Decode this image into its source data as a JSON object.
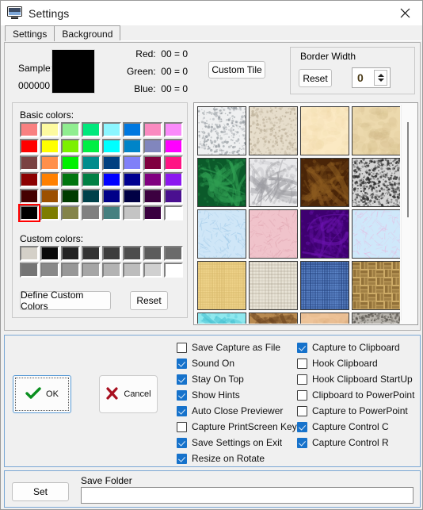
{
  "window": {
    "title": "Settings",
    "icon": "monitor-icon",
    "close_label": "✕"
  },
  "tabs": [
    {
      "label": "Settings",
      "active": false
    },
    {
      "label": "Background",
      "active": true
    }
  ],
  "background_tab": {
    "sample": {
      "label": "Sample:",
      "hex": "000000",
      "color": "#000000"
    },
    "channels": [
      {
        "name": "Red:",
        "hex": "00",
        "value": "0",
        "text": "Red:  00 = 0"
      },
      {
        "name": "Green:",
        "hex": "00",
        "value": "0",
        "text": "Green:  00 = 0"
      },
      {
        "name": "Blue:",
        "hex": "00",
        "value": "0",
        "text": "Blue:  00 = 0"
      }
    ],
    "custom_tile_button": "Custom Tile",
    "border_width": {
      "legend": "Border Width",
      "reset_label": "Reset",
      "value": "0"
    },
    "colors": {
      "basic_label": "Basic colors:",
      "custom_label": "Custom colors:",
      "define_custom_label": "Define Custom Colors",
      "reset_label": "Reset",
      "selected_index": 40,
      "basic": [
        "#f98080",
        "#fdfaa0",
        "#90ee90",
        "#00e87c",
        "#8cf6ff",
        "#0078e0",
        "#fa8ac0",
        "#fa8afa",
        "#ff0000",
        "#ffff00",
        "#7cf000",
        "#00ee44",
        "#00ffff",
        "#0084c8",
        "#8186bd",
        "#ff00ff",
        "#7a4242",
        "#ff8f4a",
        "#00f000",
        "#008c8c",
        "#004080",
        "#8080f8",
        "#800040",
        "#ff1484",
        "#8c0000",
        "#ff8000",
        "#00760f",
        "#008044",
        "#0000ff",
        "#000090",
        "#800080",
        "#8c17f0",
        "#450000",
        "#9c5000",
        "#003c00",
        "#00414a",
        "#000088",
        "#000044",
        "#3c0040",
        "#4a1090",
        "#000000",
        "#7d7d00",
        "#84844a",
        "#808080",
        "#458080",
        "#c4c4c4",
        "#3a0040",
        "#ffffff"
      ],
      "custom": [
        "#d4d0c8",
        "#0a0a0a",
        "#232323",
        "#333333",
        "#3d3d3d",
        "#4d4d4d",
        "#5c5c5c",
        "#6b6b6b",
        "#757575",
        "#898989",
        "#989898",
        "#a6a6a6",
        "#b3b3b3",
        "#bdbdbd",
        "#d0d0d0",
        "#ffffff"
      ]
    },
    "tiles": [
      {
        "name": "white-speckle-tile",
        "base": "#eff0f1",
        "spot": "#9aa0a5",
        "style": "speckle"
      },
      {
        "name": "beige-sand-tile",
        "base": "#e6ddcb",
        "spot": "#bfb39c",
        "style": "speckle"
      },
      {
        "name": "cream-parchment-tile",
        "base": "#fbe9c3",
        "spot": "#f0d9a8",
        "style": "soft"
      },
      {
        "name": "tan-parchment-tile",
        "base": "#ecd9ad",
        "spot": "#cfb684",
        "style": "soft"
      },
      {
        "name": "green-marble-tile",
        "base": "#0b5a2a",
        "spot": "#2f9e52",
        "style": "marble"
      },
      {
        "name": "white-marble-tile",
        "base": "#e8e8ea",
        "spot": "#9b9ba0",
        "style": "marble"
      },
      {
        "name": "brown-wood-tile",
        "base": "#4a2508",
        "spot": "#8d5c20",
        "style": "marble"
      },
      {
        "name": "granite-gray-tile",
        "base": "#d5d5d5",
        "spot": "#2b2b2b",
        "style": "granite"
      },
      {
        "name": "light-blue-tile",
        "base": "#cfe6f7",
        "spot": "#9fc9e8",
        "style": "fiber"
      },
      {
        "name": "pink-tile",
        "base": "#f0c3cb",
        "spot": "#dfa4b0",
        "style": "fiber"
      },
      {
        "name": "purple-tile",
        "base": "#3e0070",
        "spot": "#6a13ad",
        "style": "marble"
      },
      {
        "name": "pastel-mix-tile",
        "base": "#cfe8fa",
        "spot": "#e6b8e0",
        "style": "fiber"
      },
      {
        "name": "yellow-linen-tile",
        "base": "#efd38a",
        "spot": "#d8b96c",
        "style": "weave"
      },
      {
        "name": "beige-grid-tile",
        "base": "#e8e3d6",
        "spot": "#9c9380",
        "style": "grid"
      },
      {
        "name": "blue-burlap-tile",
        "base": "#5d86c9",
        "spot": "#23407c",
        "style": "weave"
      },
      {
        "name": "wicker-tile",
        "base": "#cdab67",
        "spot": "#7d5d2a",
        "style": "basket"
      },
      {
        "name": "cyan-water-tile",
        "base": "#8fe8ee",
        "spot": "#47c2d2",
        "style": "marble"
      },
      {
        "name": "woodgrain-tile",
        "base": "#b98a50",
        "spot": "#6d4520",
        "style": "marble"
      },
      {
        "name": "peach-tile",
        "base": "#eec49a",
        "spot": "#d9a877",
        "style": "soft"
      },
      {
        "name": "stone-gray-tile",
        "base": "#b9b5ae",
        "spot": "#5a5650",
        "style": "granite"
      }
    ]
  },
  "options": {
    "column1": [
      {
        "label": "Save Capture as File",
        "checked": false
      },
      {
        "label": "Sound On",
        "checked": true
      },
      {
        "label": "Stay On Top",
        "checked": true
      },
      {
        "label": "Show Hints",
        "checked": true
      },
      {
        "label": "Auto Close Previewer",
        "checked": true
      },
      {
        "label": "Capture PrintScreen Key",
        "checked": false
      },
      {
        "label": "Save Settings on Exit",
        "checked": true
      },
      {
        "label": "Resize on Rotate",
        "checked": true
      }
    ],
    "column2": [
      {
        "label": "Capture to Clipboard",
        "checked": true
      },
      {
        "label": "Hook Clipboard",
        "checked": false
      },
      {
        "label": "Hook Clipboard StartUp",
        "checked": false
      },
      {
        "label": "Clipboard to PowerPoint",
        "checked": false
      },
      {
        "label": "Capture to PowerPoint",
        "checked": false
      },
      {
        "label": "Capture Control C",
        "checked": true
      },
      {
        "label": "Capture Control R",
        "checked": true
      }
    ],
    "ok_label": "OK",
    "cancel_label": "Cancel"
  },
  "save_folder": {
    "set_label": "Set",
    "label": "Save Folder",
    "value": "",
    "placeholder": ""
  },
  "colors_meta": {
    "accent": "#1672cb",
    "selection_outline": "#ff0000",
    "panel_border": "#7aa7d4"
  }
}
